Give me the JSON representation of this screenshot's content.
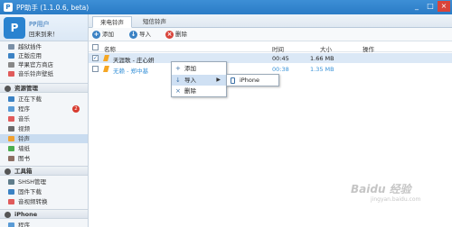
{
  "window": {
    "title": "PP助手 (1.1.0.6, beta)",
    "logo": "P",
    "controls": [
      "_",
      "□",
      "×"
    ]
  },
  "user": {
    "avatar": "P",
    "name": "PP用户",
    "greeting": "回来到来！"
  },
  "sidebar": {
    "top_items": [
      {
        "label": "越狱插件",
        "icon": "plugin-icon",
        "color": "#7a8fa6"
      },
      {
        "label": "正版应用",
        "icon": "app-icon",
        "color": "#3b82c4"
      },
      {
        "label": "苹果官方商店",
        "icon": "store-icon",
        "color": "#888888"
      },
      {
        "label": "音乐铃声壁纸",
        "icon": "music-icon",
        "color": "#e05b5b"
      }
    ],
    "sections": [
      {
        "title": "资源管理",
        "icon": "resource-icon"
      },
      {
        "title": "工具箱",
        "icon": "toolbox-icon"
      },
      {
        "title": "iPhone",
        "icon": "iphone-icon"
      }
    ],
    "resource_items": [
      {
        "label": "正在下载",
        "icon": "download-icon",
        "color": "#3b82c4"
      },
      {
        "label": "程序",
        "icon": "program-icon",
        "color": "#5a9bd5",
        "badge": "2"
      },
      {
        "label": "音乐",
        "icon": "music-icon",
        "color": "#e05b5b"
      },
      {
        "label": "视频",
        "icon": "video-icon",
        "color": "#6a6a6a"
      },
      {
        "label": "铃声",
        "icon": "bell-icon",
        "color": "#f0a030"
      },
      {
        "label": "墙纸",
        "icon": "wallpaper-icon",
        "color": "#4caf50"
      },
      {
        "label": "图书",
        "icon": "book-icon",
        "color": "#8d6e63"
      }
    ],
    "tool_items": [
      {
        "label": "SHSH管理",
        "icon": "shsh-icon",
        "color": "#607d8b"
      },
      {
        "label": "固件下载",
        "icon": "firmware-icon",
        "color": "#3b82c4"
      },
      {
        "label": "音视频转换",
        "icon": "convert-icon",
        "color": "#e05b5b"
      }
    ],
    "iphone_items": [
      {
        "label": "程序",
        "icon": "program-icon",
        "color": "#5a9bd5"
      }
    ]
  },
  "tabs": [
    "来电铃声",
    "短信铃声"
  ],
  "toolbar": {
    "add": "添加",
    "import": "导入",
    "delete": "删除"
  },
  "table": {
    "headers": {
      "name": "名称",
      "time": "时间",
      "size": "大小",
      "action": "操作"
    },
    "rows": [
      {
        "checked": "✓",
        "name": "天涯歌 - 庄心妍",
        "time": "00:45",
        "size": "1.66 MB"
      },
      {
        "checked": "",
        "name": "无赖 - 郑中基",
        "time": "00:38",
        "size": "1.35 MB"
      }
    ]
  },
  "context_menu": {
    "add": "添加",
    "import": "导入",
    "delete": "删除",
    "submenu_item": "iPhone"
  },
  "watermark": {
    "text": "Baidu 经验",
    "sub": "jingyan.baidu.com"
  },
  "colors": {
    "titlebar": "#2a7bc6",
    "selected_row": "#dbe8f6",
    "active_side": "#c9dcf0",
    "delete": "#d9443a"
  }
}
